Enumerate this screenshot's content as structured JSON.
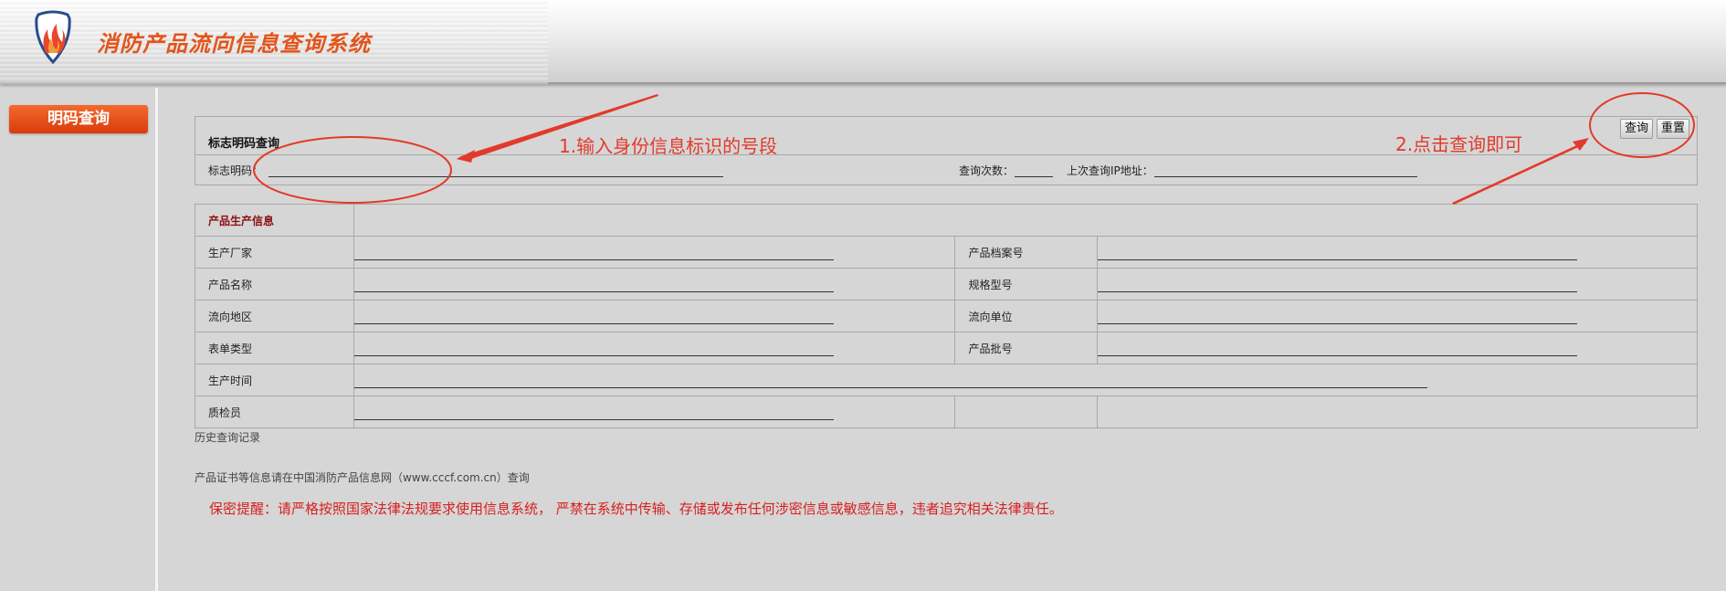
{
  "header": {
    "app_title": "消防产品流向信息查询系统",
    "logo_icon": "fire-shield-logo"
  },
  "sidebar": {
    "nav_label": "明码查询"
  },
  "search": {
    "title": "标志明码查询",
    "code_label": "标志明码：",
    "code_value": "",
    "query_count_label": "查询次数：",
    "query_count_value": "",
    "last_ip_label": "上次查询IP地址：",
    "last_ip_value": "",
    "query_button": "查询",
    "reset_button": "重置"
  },
  "info": {
    "section_title": "产品生产信息",
    "rows": [
      {
        "left_label": "生产厂家",
        "left_value": "",
        "right_label": "产品档案号",
        "right_value": ""
      },
      {
        "left_label": "产品名称",
        "left_value": "",
        "right_label": "规格型号",
        "right_value": ""
      },
      {
        "left_label": "流向地区",
        "left_value": "",
        "right_label": "流向单位",
        "right_value": ""
      },
      {
        "left_label": "表单类型",
        "left_value": "",
        "right_label": "产品批号",
        "right_value": ""
      }
    ],
    "production_time_label": "生产时间",
    "production_time_value": "",
    "inspector_label": "质检员",
    "inspector_value": ""
  },
  "footer": {
    "history_link": "历史查询记录",
    "cert_note": "产品证书等信息请在中国消防产品信息网（www.cccf.com.cn）查询",
    "warning": "保密提醒：请严格按照国家法律法规要求使用信息系统， 严禁在系统中传输、存储或发布任何涉密信息或敏感信息，违者追究相关法律责任。"
  },
  "annotations": {
    "step1": "1.输入身份信息标识的号段",
    "step2": "2.点击查询即可",
    "color": "#e23a2a"
  }
}
